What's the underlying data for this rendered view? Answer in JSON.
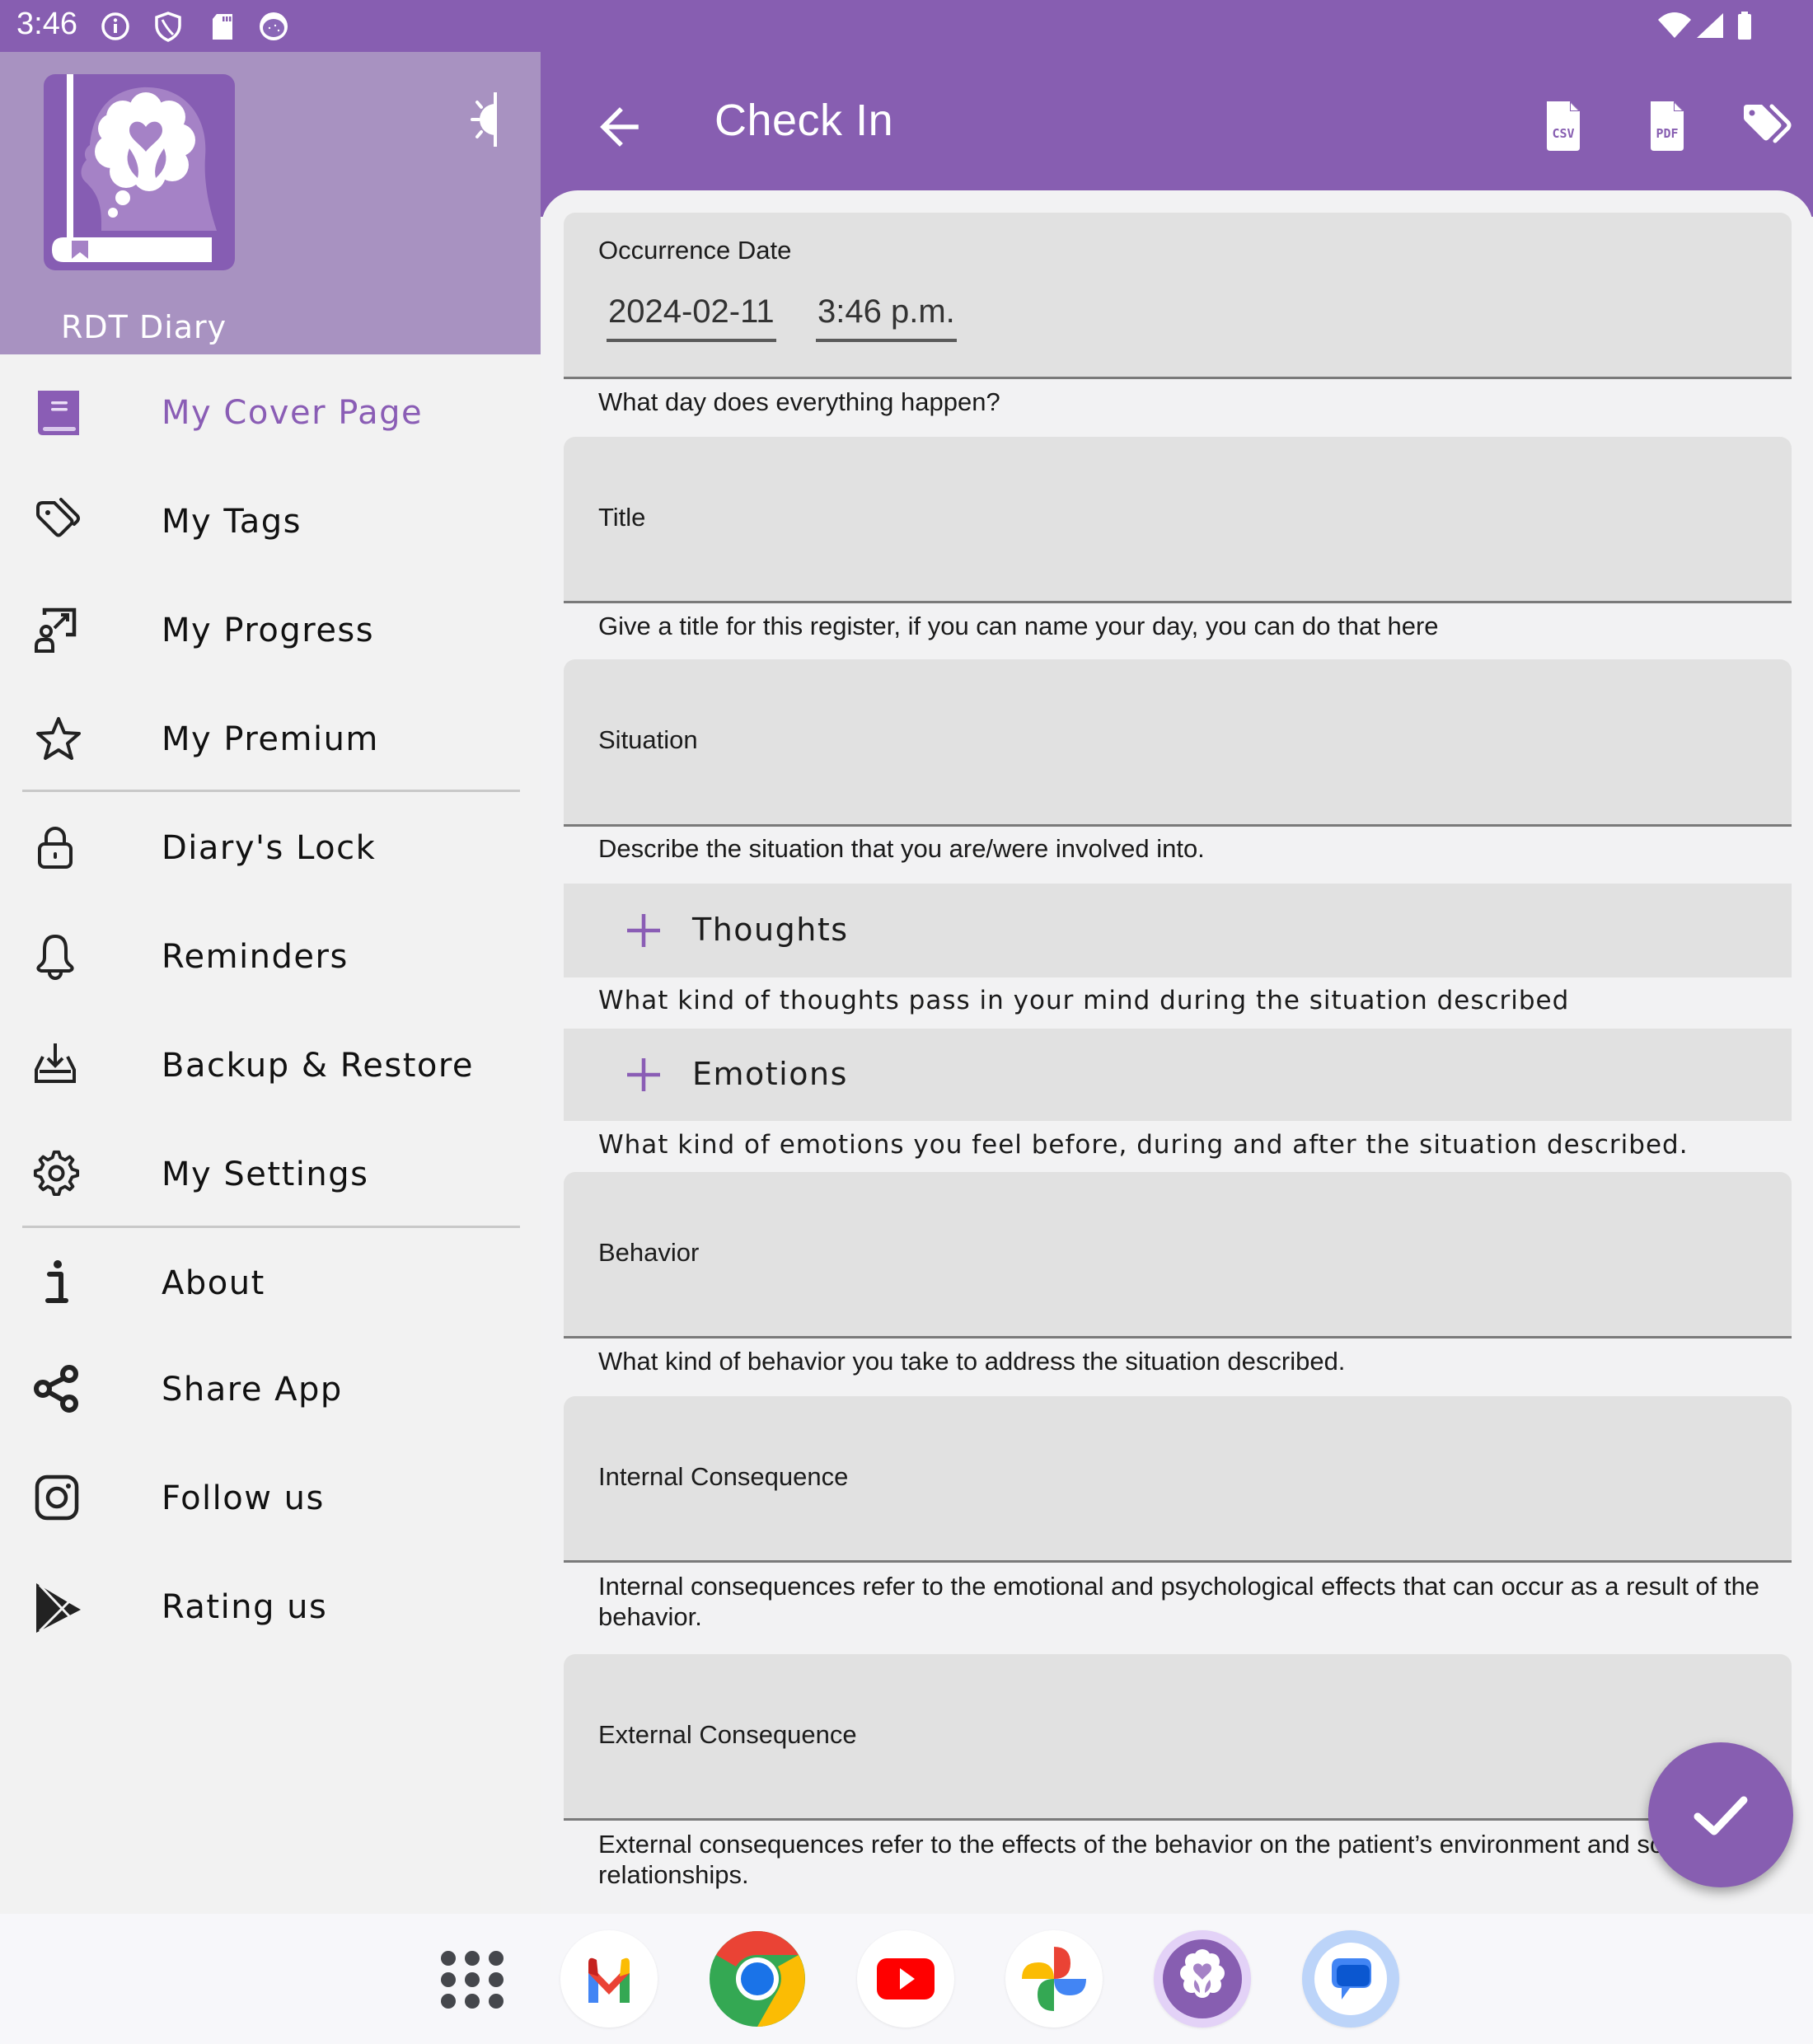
{
  "status_bar": {
    "time": "3:46",
    "left_icons": [
      "info-icon",
      "shield-icon",
      "sd-card-icon",
      "app-notification-icon"
    ],
    "right_icons": [
      "wifi-icon",
      "signal-icon",
      "battery-icon"
    ]
  },
  "drawer": {
    "app_name": "RDT Diary",
    "theme_toggle_icon": "light-dark-toggle-icon",
    "items": [
      {
        "label": "My Cover Page",
        "icon": "book-icon",
        "active": true
      },
      {
        "label": "My Tags",
        "icon": "tags-icon",
        "active": false
      },
      {
        "label": "My Progress",
        "icon": "progress-icon",
        "active": false
      },
      {
        "label": "My Premium",
        "icon": "star-icon",
        "active": false
      },
      {
        "label": "Diary's Lock",
        "icon": "lock-icon",
        "active": false
      },
      {
        "label": "Reminders",
        "icon": "bell-icon",
        "active": false
      },
      {
        "label": "Backup & Restore",
        "icon": "download-tray-icon",
        "active": false
      },
      {
        "label": "My Settings",
        "icon": "gear-icon",
        "active": false
      },
      {
        "label": "About",
        "icon": "info-icon",
        "active": false
      },
      {
        "label": "Share App",
        "icon": "share-icon",
        "active": false
      },
      {
        "label": "Follow us",
        "icon": "instagram-icon",
        "active": false
      },
      {
        "label": "Rating us",
        "icon": "play-store-icon",
        "active": false
      }
    ]
  },
  "appbar": {
    "title": "Check In",
    "back_icon": "arrow-back-icon",
    "actions": [
      {
        "name": "export-csv",
        "icon": "csv-file-icon",
        "glyph": "CSV"
      },
      {
        "name": "export-pdf",
        "icon": "pdf-file-icon",
        "glyph": "PDF"
      },
      {
        "name": "tags",
        "icon": "tags-icon"
      }
    ]
  },
  "form": {
    "occurrence": {
      "label": "Occurrence Date",
      "date_value": "2024-02-11",
      "time_value": "3:46 p.m.",
      "helper": "What day does everything happen?"
    },
    "title": {
      "label": "Title",
      "value": "",
      "helper": "Give a title for this register, if you can name your day, you can do that here"
    },
    "situation": {
      "label": "Situation",
      "value": "",
      "helper": "Describe the situation that you are/were involved into."
    },
    "thoughts": {
      "label": "Thoughts",
      "helper": "What kind of thoughts pass in your mind during the situation described"
    },
    "emotions": {
      "label": "Emotions",
      "helper": "What kind of emotions you feel before, during and after the situation described."
    },
    "behavior": {
      "label": "Behavior",
      "value": "",
      "helper": "What kind of behavior you take to address the situation described."
    },
    "internal_consequence": {
      "label": "Internal Consequence",
      "value": "",
      "helper": "Internal consequences refer to the emotional and psychological effects that can occur as a result of the behavior."
    },
    "external_consequence": {
      "label": "External Consequence",
      "value": "",
      "helper": "External consequences refer to the effects of the behavior on the patient’s environment and social relationships."
    }
  },
  "fab": {
    "icon": "check-icon",
    "label": "Save"
  },
  "dock": {
    "apps": [
      {
        "name": "app-drawer",
        "icon": "app-grid-icon"
      },
      {
        "name": "gmail",
        "icon": "gmail-icon"
      },
      {
        "name": "chrome",
        "icon": "chrome-icon"
      },
      {
        "name": "youtube",
        "icon": "youtube-icon"
      },
      {
        "name": "photos",
        "icon": "photos-icon"
      },
      {
        "name": "rdt-diary",
        "icon": "rdt-diary-icon"
      },
      {
        "name": "messages",
        "icon": "messages-icon"
      }
    ]
  },
  "colors": {
    "primary": "#875eb1",
    "drawer_header": "#a892c1",
    "active_item": "#8a5db5",
    "field_bg": "#e1e1e1",
    "page_bg": "#f2f2f2"
  }
}
